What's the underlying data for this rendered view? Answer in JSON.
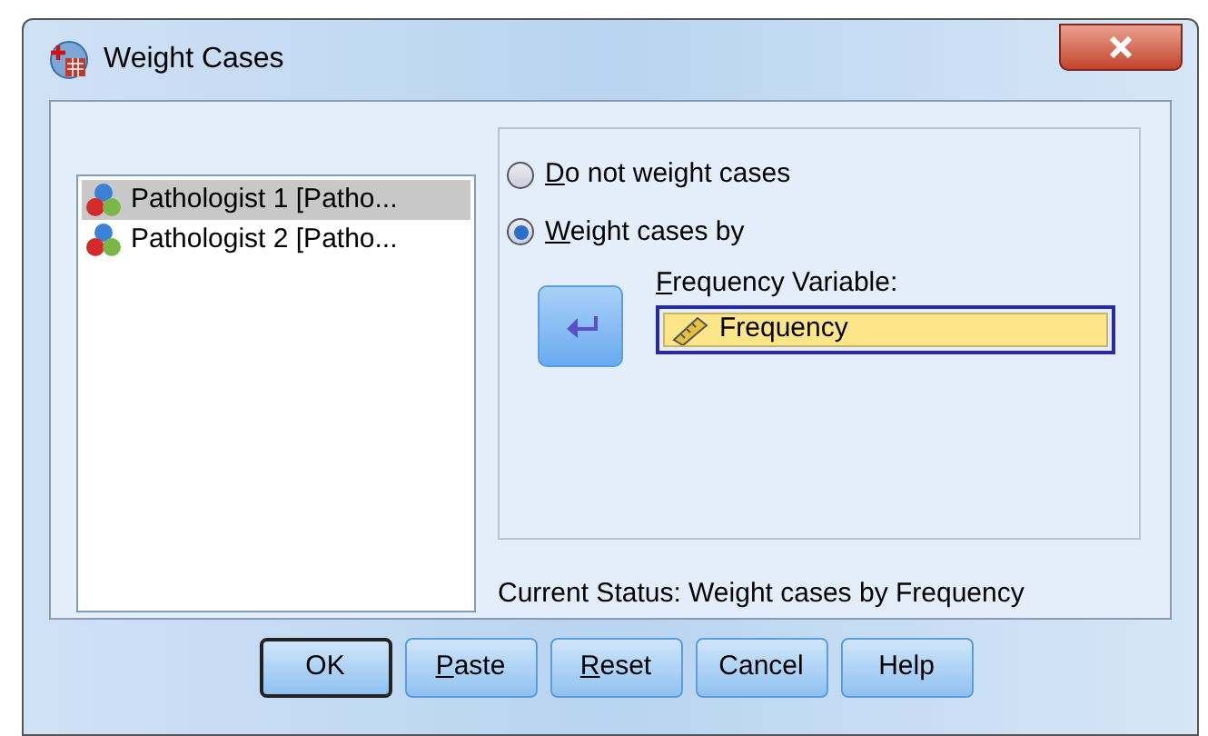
{
  "window": {
    "title": "Weight Cases"
  },
  "variables": [
    {
      "label": "Pathologist 1 [Patho...",
      "selected": true
    },
    {
      "label": "Pathologist 2 [Patho...",
      "selected": false
    }
  ],
  "options": [
    {
      "label": "Do not weight cases",
      "selected": false,
      "mnemonic": true
    },
    {
      "label": "Weight cases by",
      "selected": true,
      "mnemonic": true
    }
  ],
  "frequency_variable": {
    "label": "Frequency Variable:",
    "mnemonic": true,
    "value": "Frequency"
  },
  "current_status": "Current Status: Weight cases by Frequency",
  "buttons": [
    {
      "label": "OK",
      "default": true,
      "mnemonic": false
    },
    {
      "label": "Paste",
      "default": false,
      "mnemonic": true
    },
    {
      "label": "Reset",
      "default": false,
      "mnemonic": true
    },
    {
      "label": "Cancel",
      "default": false,
      "mnemonic": false
    },
    {
      "label": "Help",
      "default": false,
      "mnemonic": false
    }
  ]
}
